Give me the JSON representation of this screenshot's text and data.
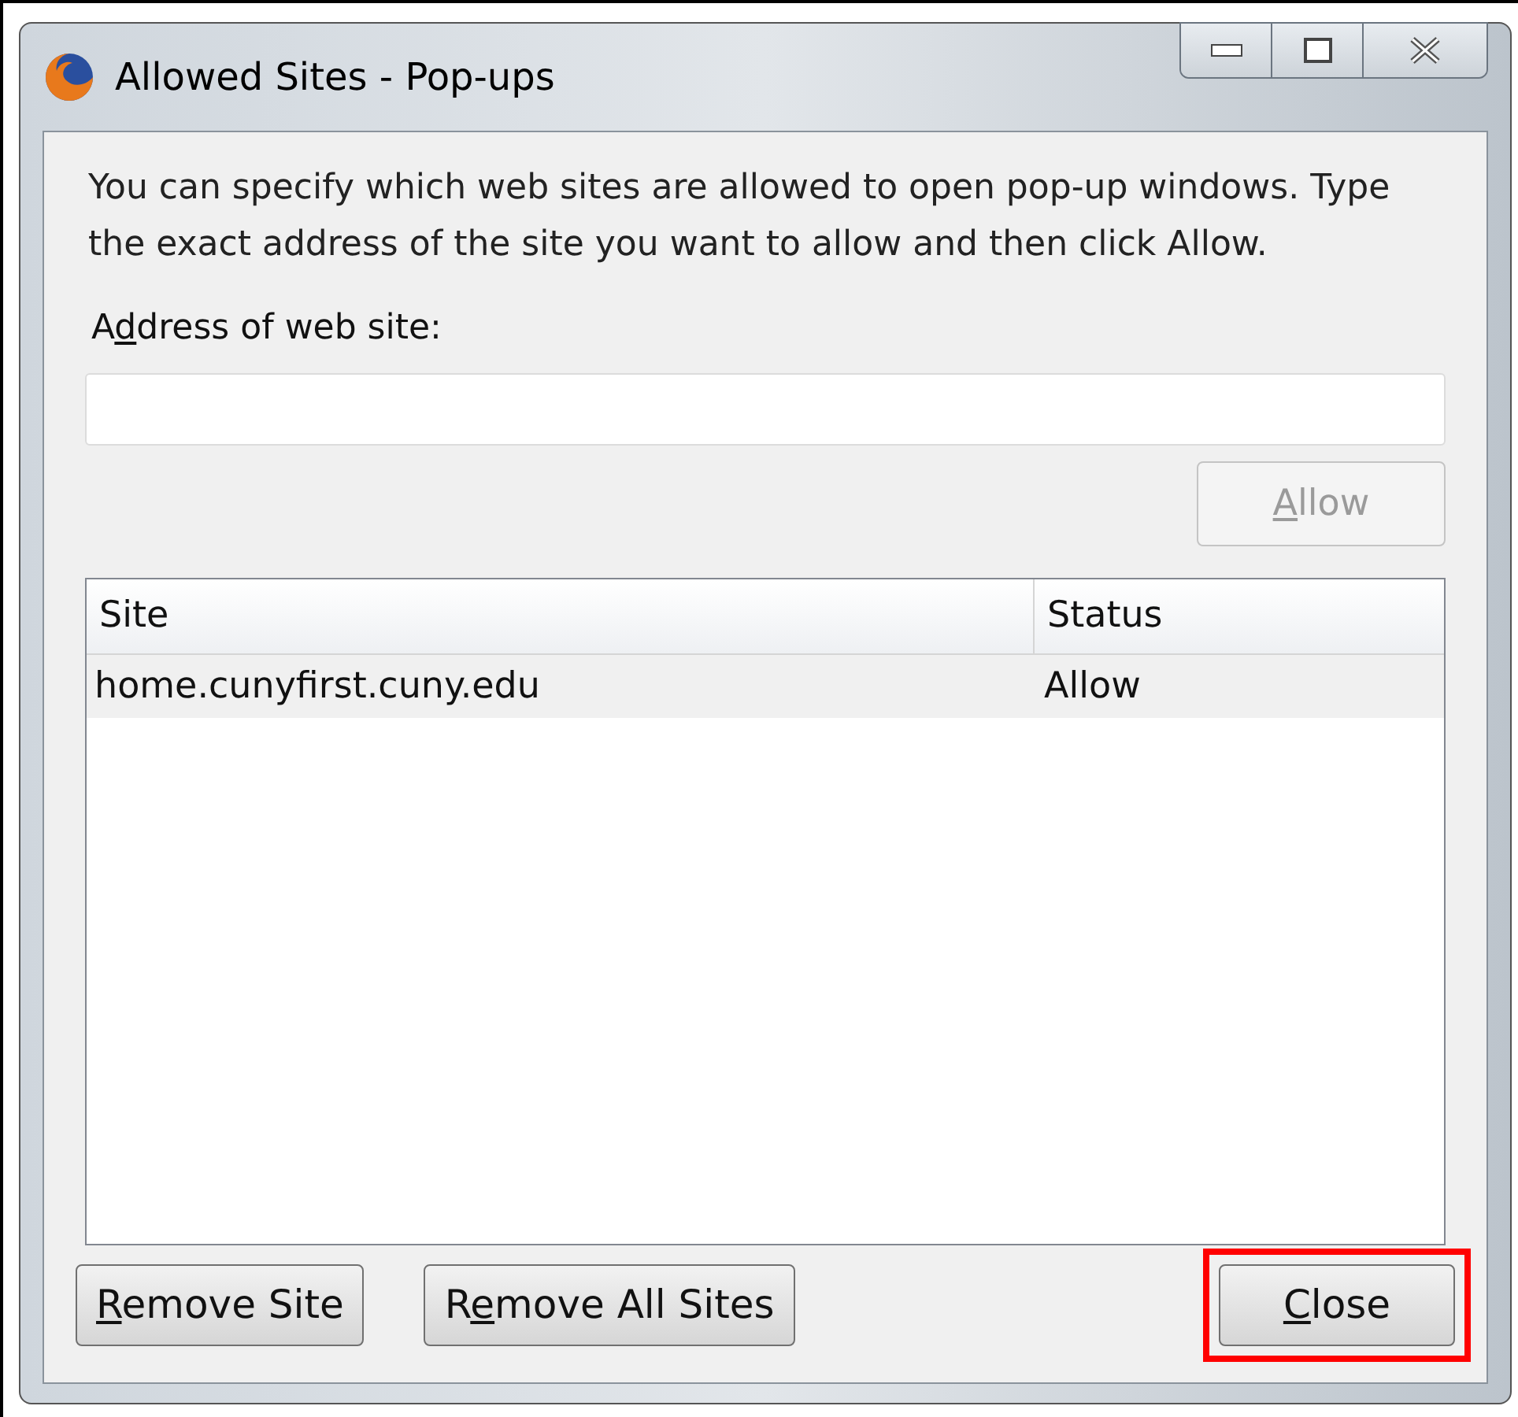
{
  "window": {
    "title": "Allowed Sites - Pop-ups"
  },
  "description": "You can specify which web sites are allowed to open pop-up windows. Type the exact address of the site you want to allow and then click Allow.",
  "address": {
    "label": {
      "before": "A",
      "key": "d",
      "after": "dress of web site:"
    }
  },
  "allow_button": {
    "label": {
      "key": "A",
      "after": "llow"
    },
    "disabled": true
  },
  "table": {
    "columns": [
      "Site",
      "Status"
    ],
    "rows": [
      {
        "site": "home.cunyfirst.cuny.edu",
        "status": "Allow",
        "selected": true
      }
    ]
  },
  "buttons": [
    {
      "label": {
        "key": "R",
        "after": "emove Site"
      },
      "highlighted": false
    },
    {
      "label": {
        "before": "R",
        "key": "e",
        "after": "move All Sites"
      },
      "highlighted": false
    },
    {
      "label": {
        "key": "C",
        "after": "lose"
      },
      "highlighted": true
    }
  ]
}
